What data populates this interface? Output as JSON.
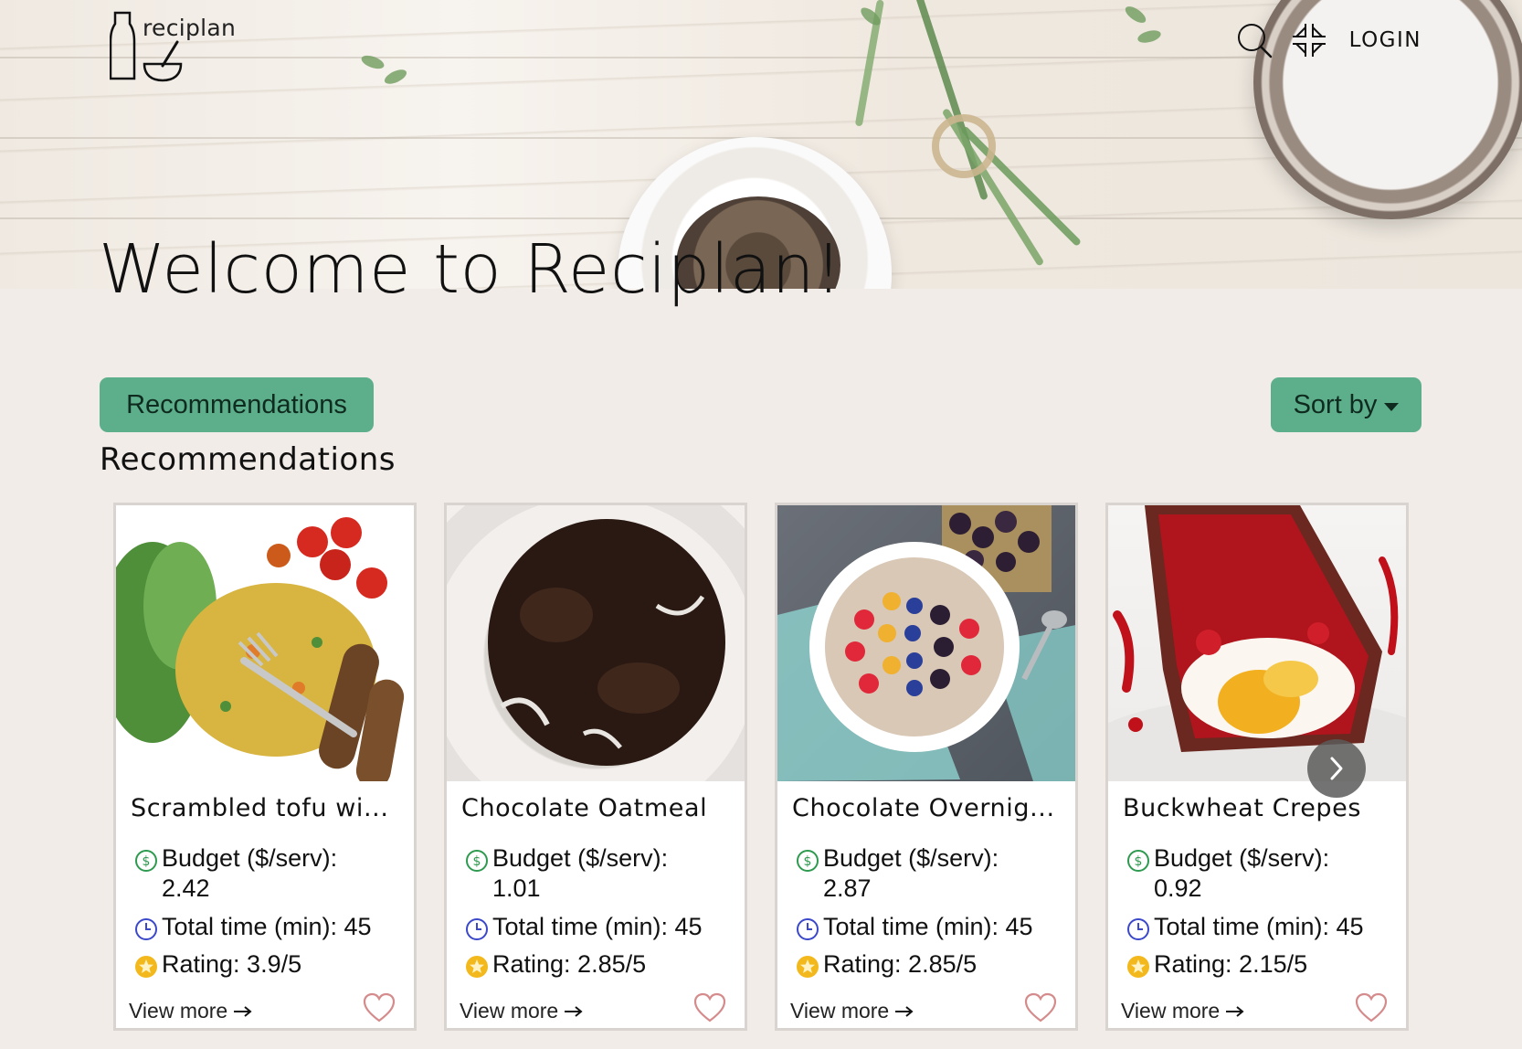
{
  "header": {
    "logo_text": "reciplan",
    "login_label": "LOGIN"
  },
  "hero": {
    "title": "Welcome to Reciplan!"
  },
  "toolbar": {
    "recommendations_label": "Recommendations",
    "sort_label": "Sort by"
  },
  "section": {
    "title": "Recommendations"
  },
  "cards": [
    {
      "name": "Scrambled tofu wi...",
      "budget_label": "Budget ($/serv):",
      "budget_value": "2.42",
      "time_text": "Total time (min): 45",
      "rating_text": "Rating: 3.9/5",
      "view_more": "View more"
    },
    {
      "name": "Chocolate Oatmeal",
      "budget_label": "Budget ($/serv):",
      "budget_value": "1.01",
      "time_text": "Total time (min): 45",
      "rating_text": "Rating: 2.85/5",
      "view_more": "View more"
    },
    {
      "name": "Chocolate Overnig...",
      "budget_label": "Budget ($/serv):",
      "budget_value": "2.87",
      "time_text": "Total time (min): 45",
      "rating_text": "Rating: 2.85/5",
      "view_more": "View more"
    },
    {
      "name": "Buckwheat Crepes",
      "budget_label": "Budget ($/serv):",
      "budget_value": "0.92",
      "time_text": "Total time (min): 45",
      "rating_text": "Rating: 2.15/5",
      "view_more": "View more"
    }
  ],
  "icons": {
    "search": "search-icon",
    "toggle": "compress-arrows-icon",
    "budget": "dollar-circle-icon",
    "time": "clock-icon",
    "rating": "star-icon",
    "favorite": "heart-icon",
    "next": "chevron-right-icon"
  },
  "colors": {
    "accent": "#5daf8c",
    "background": "#f1ece8",
    "heart": "#d58b8b",
    "budget_icon": "#2e9a4f",
    "clock_icon": "#3a48c9",
    "star_icon": "#f2b81c"
  }
}
